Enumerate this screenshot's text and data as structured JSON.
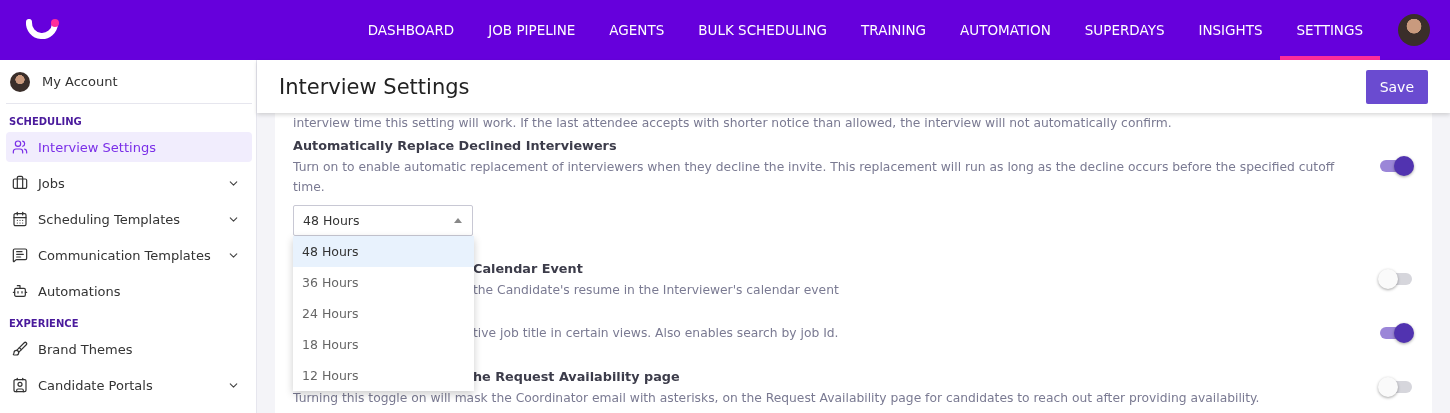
{
  "nav": [
    {
      "label": "DASHBOARD",
      "selected": false
    },
    {
      "label": "JOB PIPELINE",
      "selected": false
    },
    {
      "label": "AGENTS",
      "selected": false
    },
    {
      "label": "BULK SCHEDULING",
      "selected": false
    },
    {
      "label": "TRAINING",
      "selected": false
    },
    {
      "label": "AUTOMATION",
      "selected": false
    },
    {
      "label": "SUPERDAYS",
      "selected": false
    },
    {
      "label": "INSIGHTS",
      "selected": false
    },
    {
      "label": "SETTINGS",
      "selected": true
    }
  ],
  "sidebar": {
    "account": "My Account",
    "sections": [
      {
        "heading": "SCHEDULING",
        "items": [
          {
            "label": "Interview Settings",
            "selected": true,
            "expandable": false
          },
          {
            "label": "Jobs",
            "selected": false,
            "expandable": true
          },
          {
            "label": "Scheduling Templates",
            "selected": false,
            "expandable": true
          },
          {
            "label": "Communication Templates",
            "selected": false,
            "expandable": true
          },
          {
            "label": "Automations",
            "selected": false,
            "expandable": false
          }
        ]
      },
      {
        "heading": "EXPERIENCE",
        "items": [
          {
            "label": "Brand Themes",
            "selected": false,
            "expandable": false
          },
          {
            "label": "Candidate Portals",
            "selected": false,
            "expandable": true
          }
        ]
      }
    ]
  },
  "page": {
    "title": "Interview Settings",
    "save": "Save"
  },
  "intro": "interview time this setting will work. If the last attendee accepts with shorter notice than allowed, the interview will not automatically confirm.",
  "replace": {
    "title": "Automatically Replace Declined Interviewers",
    "description": "Turn on to enable automatic replacement of interviewers when they decline the invite. This replacement will run as long as the decline occurs before the specified cutoff time.",
    "on": true,
    "select": {
      "value": "48 Hours",
      "expanded": true,
      "options": [
        {
          "label": "48 Hours",
          "selected": true
        },
        {
          "label": "36 Hours",
          "selected": false
        },
        {
          "label": "24 Hours",
          "selected": false
        },
        {
          "label": "18 Hours",
          "selected": false
        },
        {
          "label": "12 Hours",
          "selected": false
        }
      ]
    }
  },
  "settings": [
    {
      "title": "Calendar Event",
      "description": "the Candidate's resume in the Interviewer's calendar event",
      "on": false
    },
    {
      "description": "tive job title in certain views. Also enables search by job Id.",
      "on": true
    },
    {
      "title": "he Request Availability page",
      "description": "Turning this toggle on will mask the Coordinator email with asterisks, on the Request Availability page for candidates to reach out after providing availability.",
      "on": false
    }
  ]
}
